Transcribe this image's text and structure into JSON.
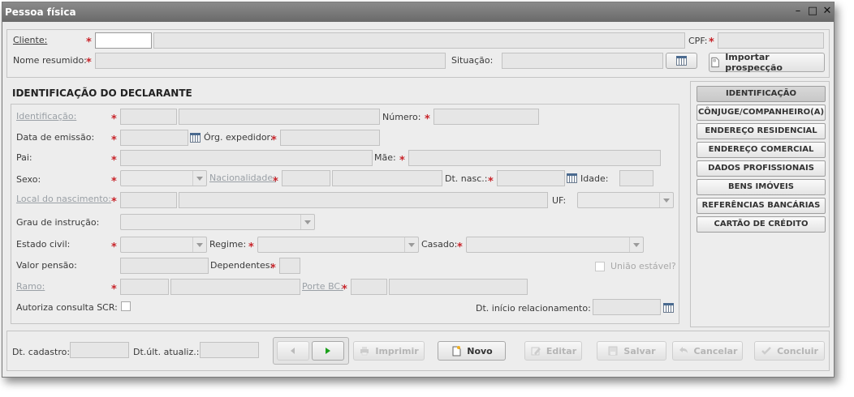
{
  "window": {
    "title": "Pessoa física",
    "controls": {
      "minimize": "–",
      "maximize": "□",
      "close": "✕"
    }
  },
  "header": {
    "cliente": "Cliente:",
    "cpf": "CPF:",
    "nome_resumido": "Nome resumido:",
    "situacao": "Situação:",
    "importar": "Importar prospecção"
  },
  "section_title": "IDENTIFICAÇÃO DO DECLARANTE",
  "form": {
    "identificacao": "Identificação:",
    "numero": "Número:",
    "data_emissao": "Data de emissão:",
    "org_expedidor": "Órg. expedidor:",
    "pai": "Pai:",
    "mae": "Mãe:",
    "sexo": "Sexo:",
    "nacionalidade": "Nacionalidade:",
    "dt_nasc": "Dt. nasc.:",
    "idade": "Idade:",
    "local_nascimento": "Local do nascimento:",
    "uf": "UF:",
    "grau_instrucao": "Grau de instrução:",
    "estado_civil": "Estado civil:",
    "regime": "Regime:",
    "casado": "Casado:",
    "valor_pensao": "Valor pensão:",
    "dependentes": "Dependentes:",
    "uniao_estavel": "União estável?",
    "ramo": "Ramo:",
    "porte_bc": "Porte BC:",
    "autoriza_scr": "Autoriza consulta SCR:",
    "dt_inicio": "Dt. início relacionamento:"
  },
  "side_menu": [
    "IDENTIFICAÇÃO",
    "CÔNJUGE/COMPANHEIRO(A)",
    "ENDEREÇO RESIDENCIAL",
    "ENDEREÇO COMERCIAL",
    "DADOS PROFISSIONAIS",
    "BENS IMÓVEIS",
    "REFERÊNCIAS BANCÁRIAS",
    "CARTÃO DE CRÉDITO"
  ],
  "footer": {
    "dt_cadastro": "Dt. cadastro:",
    "dt_ult_atualiz": "Dt.últ. atualiz.:",
    "imprimir": "Imprimir",
    "novo": "Novo",
    "editar": "Editar",
    "salvar": "Salvar",
    "cancelar": "Cancelar",
    "concluir": "Concluir"
  },
  "colors": {
    "required": "#c8242a",
    "titlebar": "#7a7a7a",
    "play": "#1aa01a"
  }
}
